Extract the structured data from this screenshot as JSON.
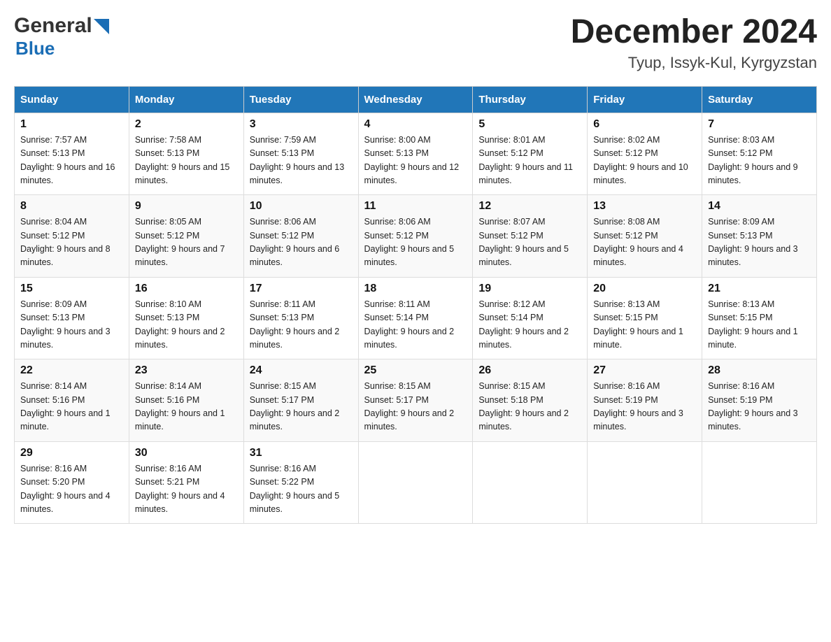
{
  "logo": {
    "general": "General",
    "blue": "Blue",
    "arrow_color": "#1a6db5"
  },
  "title": {
    "month_year": "December 2024",
    "location": "Tyup, Issyk-Kul, Kyrgyzstan"
  },
  "headers": [
    "Sunday",
    "Monday",
    "Tuesday",
    "Wednesday",
    "Thursday",
    "Friday",
    "Saturday"
  ],
  "weeks": [
    [
      {
        "day": "1",
        "sunrise": "Sunrise: 7:57 AM",
        "sunset": "Sunset: 5:13 PM",
        "daylight": "Daylight: 9 hours and 16 minutes."
      },
      {
        "day": "2",
        "sunrise": "Sunrise: 7:58 AM",
        "sunset": "Sunset: 5:13 PM",
        "daylight": "Daylight: 9 hours and 15 minutes."
      },
      {
        "day": "3",
        "sunrise": "Sunrise: 7:59 AM",
        "sunset": "Sunset: 5:13 PM",
        "daylight": "Daylight: 9 hours and 13 minutes."
      },
      {
        "day": "4",
        "sunrise": "Sunrise: 8:00 AM",
        "sunset": "Sunset: 5:13 PM",
        "daylight": "Daylight: 9 hours and 12 minutes."
      },
      {
        "day": "5",
        "sunrise": "Sunrise: 8:01 AM",
        "sunset": "Sunset: 5:12 PM",
        "daylight": "Daylight: 9 hours and 11 minutes."
      },
      {
        "day": "6",
        "sunrise": "Sunrise: 8:02 AM",
        "sunset": "Sunset: 5:12 PM",
        "daylight": "Daylight: 9 hours and 10 minutes."
      },
      {
        "day": "7",
        "sunrise": "Sunrise: 8:03 AM",
        "sunset": "Sunset: 5:12 PM",
        "daylight": "Daylight: 9 hours and 9 minutes."
      }
    ],
    [
      {
        "day": "8",
        "sunrise": "Sunrise: 8:04 AM",
        "sunset": "Sunset: 5:12 PM",
        "daylight": "Daylight: 9 hours and 8 minutes."
      },
      {
        "day": "9",
        "sunrise": "Sunrise: 8:05 AM",
        "sunset": "Sunset: 5:12 PM",
        "daylight": "Daylight: 9 hours and 7 minutes."
      },
      {
        "day": "10",
        "sunrise": "Sunrise: 8:06 AM",
        "sunset": "Sunset: 5:12 PM",
        "daylight": "Daylight: 9 hours and 6 minutes."
      },
      {
        "day": "11",
        "sunrise": "Sunrise: 8:06 AM",
        "sunset": "Sunset: 5:12 PM",
        "daylight": "Daylight: 9 hours and 5 minutes."
      },
      {
        "day": "12",
        "sunrise": "Sunrise: 8:07 AM",
        "sunset": "Sunset: 5:12 PM",
        "daylight": "Daylight: 9 hours and 5 minutes."
      },
      {
        "day": "13",
        "sunrise": "Sunrise: 8:08 AM",
        "sunset": "Sunset: 5:12 PM",
        "daylight": "Daylight: 9 hours and 4 minutes."
      },
      {
        "day": "14",
        "sunrise": "Sunrise: 8:09 AM",
        "sunset": "Sunset: 5:13 PM",
        "daylight": "Daylight: 9 hours and 3 minutes."
      }
    ],
    [
      {
        "day": "15",
        "sunrise": "Sunrise: 8:09 AM",
        "sunset": "Sunset: 5:13 PM",
        "daylight": "Daylight: 9 hours and 3 minutes."
      },
      {
        "day": "16",
        "sunrise": "Sunrise: 8:10 AM",
        "sunset": "Sunset: 5:13 PM",
        "daylight": "Daylight: 9 hours and 2 minutes."
      },
      {
        "day": "17",
        "sunrise": "Sunrise: 8:11 AM",
        "sunset": "Sunset: 5:13 PM",
        "daylight": "Daylight: 9 hours and 2 minutes."
      },
      {
        "day": "18",
        "sunrise": "Sunrise: 8:11 AM",
        "sunset": "Sunset: 5:14 PM",
        "daylight": "Daylight: 9 hours and 2 minutes."
      },
      {
        "day": "19",
        "sunrise": "Sunrise: 8:12 AM",
        "sunset": "Sunset: 5:14 PM",
        "daylight": "Daylight: 9 hours and 2 minutes."
      },
      {
        "day": "20",
        "sunrise": "Sunrise: 8:13 AM",
        "sunset": "Sunset: 5:15 PM",
        "daylight": "Daylight: 9 hours and 1 minute."
      },
      {
        "day": "21",
        "sunrise": "Sunrise: 8:13 AM",
        "sunset": "Sunset: 5:15 PM",
        "daylight": "Daylight: 9 hours and 1 minute."
      }
    ],
    [
      {
        "day": "22",
        "sunrise": "Sunrise: 8:14 AM",
        "sunset": "Sunset: 5:16 PM",
        "daylight": "Daylight: 9 hours and 1 minute."
      },
      {
        "day": "23",
        "sunrise": "Sunrise: 8:14 AM",
        "sunset": "Sunset: 5:16 PM",
        "daylight": "Daylight: 9 hours and 1 minute."
      },
      {
        "day": "24",
        "sunrise": "Sunrise: 8:15 AM",
        "sunset": "Sunset: 5:17 PM",
        "daylight": "Daylight: 9 hours and 2 minutes."
      },
      {
        "day": "25",
        "sunrise": "Sunrise: 8:15 AM",
        "sunset": "Sunset: 5:17 PM",
        "daylight": "Daylight: 9 hours and 2 minutes."
      },
      {
        "day": "26",
        "sunrise": "Sunrise: 8:15 AM",
        "sunset": "Sunset: 5:18 PM",
        "daylight": "Daylight: 9 hours and 2 minutes."
      },
      {
        "day": "27",
        "sunrise": "Sunrise: 8:16 AM",
        "sunset": "Sunset: 5:19 PM",
        "daylight": "Daylight: 9 hours and 3 minutes."
      },
      {
        "day": "28",
        "sunrise": "Sunrise: 8:16 AM",
        "sunset": "Sunset: 5:19 PM",
        "daylight": "Daylight: 9 hours and 3 minutes."
      }
    ],
    [
      {
        "day": "29",
        "sunrise": "Sunrise: 8:16 AM",
        "sunset": "Sunset: 5:20 PM",
        "daylight": "Daylight: 9 hours and 4 minutes."
      },
      {
        "day": "30",
        "sunrise": "Sunrise: 8:16 AM",
        "sunset": "Sunset: 5:21 PM",
        "daylight": "Daylight: 9 hours and 4 minutes."
      },
      {
        "day": "31",
        "sunrise": "Sunrise: 8:16 AM",
        "sunset": "Sunset: 5:22 PM",
        "daylight": "Daylight: 9 hours and 5 minutes."
      },
      {
        "day": "",
        "sunrise": "",
        "sunset": "",
        "daylight": ""
      },
      {
        "day": "",
        "sunrise": "",
        "sunset": "",
        "daylight": ""
      },
      {
        "day": "",
        "sunrise": "",
        "sunset": "",
        "daylight": ""
      },
      {
        "day": "",
        "sunrise": "",
        "sunset": "",
        "daylight": ""
      }
    ]
  ]
}
